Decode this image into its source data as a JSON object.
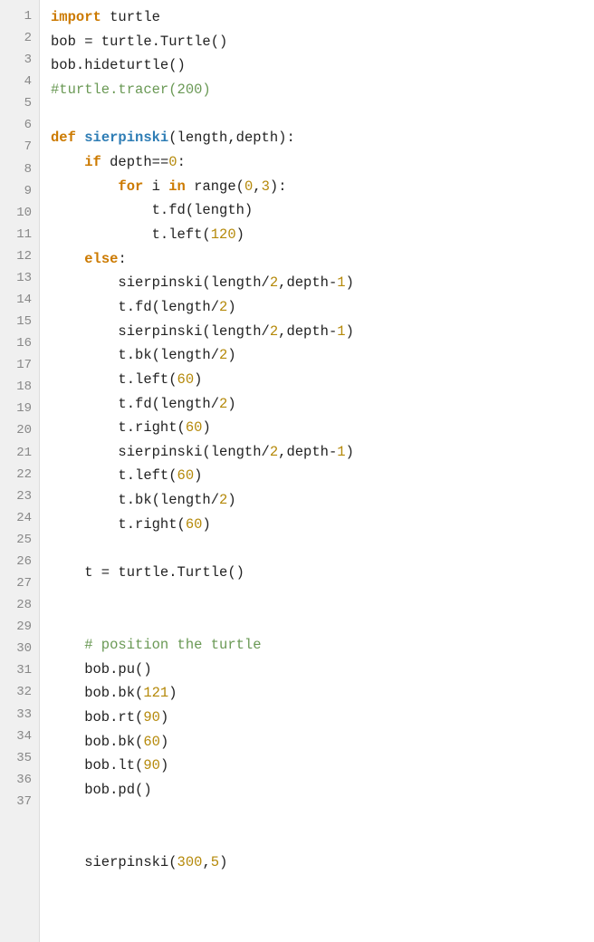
{
  "editor": {
    "lines": [
      {
        "num": 1,
        "tokens": [
          {
            "t": "kw",
            "v": "import"
          },
          {
            "t": "plain",
            "v": " turtle"
          }
        ]
      },
      {
        "num": 2,
        "tokens": [
          {
            "t": "plain",
            "v": "bob = turtle.Turtle()"
          }
        ]
      },
      {
        "num": 3,
        "tokens": [
          {
            "t": "plain",
            "v": "bob.hideturtle()"
          }
        ]
      },
      {
        "num": 4,
        "tokens": [
          {
            "t": "cm",
            "v": "#turtle.tracer(200)"
          }
        ]
      },
      {
        "num": 5,
        "tokens": [
          {
            "t": "plain",
            "v": ""
          }
        ]
      },
      {
        "num": 6,
        "tokens": [
          {
            "t": "kw",
            "v": "def"
          },
          {
            "t": "plain",
            "v": " "
          },
          {
            "t": "fn",
            "v": "sierpinski"
          },
          {
            "t": "plain",
            "v": "(length,depth):"
          }
        ]
      },
      {
        "num": 7,
        "tokens": [
          {
            "t": "plain",
            "v": "    "
          },
          {
            "t": "kw",
            "v": "if"
          },
          {
            "t": "plain",
            "v": " depth=="
          },
          {
            "t": "num",
            "v": "0"
          },
          {
            "t": "plain",
            "v": ":"
          }
        ]
      },
      {
        "num": 8,
        "tokens": [
          {
            "t": "plain",
            "v": "        "
          },
          {
            "t": "kw",
            "v": "for"
          },
          {
            "t": "plain",
            "v": " i "
          },
          {
            "t": "kw",
            "v": "in"
          },
          {
            "t": "plain",
            "v": " range("
          },
          {
            "t": "num",
            "v": "0"
          },
          {
            "t": "plain",
            "v": ","
          },
          {
            "t": "num",
            "v": "3"
          },
          {
            "t": "plain",
            "v": "):"
          }
        ]
      },
      {
        "num": 9,
        "tokens": [
          {
            "t": "plain",
            "v": "            t.fd(length)"
          }
        ]
      },
      {
        "num": 10,
        "tokens": [
          {
            "t": "plain",
            "v": "            t.left("
          },
          {
            "t": "num",
            "v": "120"
          },
          {
            "t": "plain",
            "v": ")"
          }
        ]
      },
      {
        "num": 11,
        "tokens": [
          {
            "t": "plain",
            "v": "    "
          },
          {
            "t": "kw",
            "v": "else"
          },
          {
            "t": "plain",
            "v": ":"
          }
        ]
      },
      {
        "num": 12,
        "tokens": [
          {
            "t": "plain",
            "v": "        sierpinski(length/"
          },
          {
            "t": "num",
            "v": "2"
          },
          {
            "t": "plain",
            "v": ",depth-"
          },
          {
            "t": "num",
            "v": "1"
          },
          {
            "t": "plain",
            "v": ")"
          }
        ]
      },
      {
        "num": 13,
        "tokens": [
          {
            "t": "plain",
            "v": "        t.fd(length/"
          },
          {
            "t": "num",
            "v": "2"
          },
          {
            "t": "plain",
            "v": ")"
          }
        ]
      },
      {
        "num": 14,
        "tokens": [
          {
            "t": "plain",
            "v": "        sierpinski(length/"
          },
          {
            "t": "num",
            "v": "2"
          },
          {
            "t": "plain",
            "v": ",depth-"
          },
          {
            "t": "num",
            "v": "1"
          },
          {
            "t": "plain",
            "v": ")"
          }
        ]
      },
      {
        "num": 15,
        "tokens": [
          {
            "t": "plain",
            "v": "        t.bk(length/"
          },
          {
            "t": "num",
            "v": "2"
          },
          {
            "t": "plain",
            "v": ")"
          }
        ]
      },
      {
        "num": 16,
        "tokens": [
          {
            "t": "plain",
            "v": "        t.left("
          },
          {
            "t": "num",
            "v": "60"
          },
          {
            "t": "plain",
            "v": ")"
          }
        ]
      },
      {
        "num": 17,
        "tokens": [
          {
            "t": "plain",
            "v": "        t.fd(length/"
          },
          {
            "t": "num",
            "v": "2"
          },
          {
            "t": "plain",
            "v": ")"
          }
        ]
      },
      {
        "num": 18,
        "tokens": [
          {
            "t": "plain",
            "v": "        t.right("
          },
          {
            "t": "num",
            "v": "60"
          },
          {
            "t": "plain",
            "v": ")"
          }
        ]
      },
      {
        "num": 19,
        "tokens": [
          {
            "t": "plain",
            "v": "        sierpinski(length/"
          },
          {
            "t": "num",
            "v": "2"
          },
          {
            "t": "plain",
            "v": ",depth-"
          },
          {
            "t": "num",
            "v": "1"
          },
          {
            "t": "plain",
            "v": ")"
          }
        ]
      },
      {
        "num": 20,
        "tokens": [
          {
            "t": "plain",
            "v": "        t.left("
          },
          {
            "t": "num",
            "v": "60"
          },
          {
            "t": "plain",
            "v": ")"
          }
        ]
      },
      {
        "num": 21,
        "tokens": [
          {
            "t": "plain",
            "v": "        t.bk(length/"
          },
          {
            "t": "num",
            "v": "2"
          },
          {
            "t": "plain",
            "v": ")"
          }
        ]
      },
      {
        "num": 22,
        "tokens": [
          {
            "t": "plain",
            "v": "        t.right("
          },
          {
            "t": "num",
            "v": "60"
          },
          {
            "t": "plain",
            "v": ")"
          }
        ]
      },
      {
        "num": 23,
        "tokens": [
          {
            "t": "plain",
            "v": ""
          }
        ]
      },
      {
        "num": 24,
        "tokens": [
          {
            "t": "plain",
            "v": "    t = turtle.Turtle()"
          }
        ]
      },
      {
        "num": 25,
        "tokens": [
          {
            "t": "plain",
            "v": ""
          }
        ]
      },
      {
        "num": 26,
        "tokens": [
          {
            "t": "plain",
            "v": ""
          }
        ]
      },
      {
        "num": 27,
        "tokens": [
          {
            "t": "cm",
            "v": "    # position the turtle"
          }
        ]
      },
      {
        "num": 28,
        "tokens": [
          {
            "t": "plain",
            "v": "    bob.pu()"
          }
        ]
      },
      {
        "num": 29,
        "tokens": [
          {
            "t": "plain",
            "v": "    bob.bk("
          },
          {
            "t": "num",
            "v": "121"
          },
          {
            "t": "plain",
            "v": ")"
          }
        ]
      },
      {
        "num": 30,
        "tokens": [
          {
            "t": "plain",
            "v": "    bob.rt("
          },
          {
            "t": "num",
            "v": "90"
          },
          {
            "t": "plain",
            "v": ")"
          }
        ]
      },
      {
        "num": 31,
        "tokens": [
          {
            "t": "plain",
            "v": "    bob.bk("
          },
          {
            "t": "num",
            "v": "60"
          },
          {
            "t": "plain",
            "v": ")"
          }
        ]
      },
      {
        "num": 32,
        "tokens": [
          {
            "t": "plain",
            "v": "    bob.lt("
          },
          {
            "t": "num",
            "v": "90"
          },
          {
            "t": "plain",
            "v": ")"
          }
        ]
      },
      {
        "num": 33,
        "tokens": [
          {
            "t": "plain",
            "v": "    bob.pd()"
          }
        ]
      },
      {
        "num": 34,
        "tokens": [
          {
            "t": "plain",
            "v": ""
          }
        ]
      },
      {
        "num": 35,
        "tokens": [
          {
            "t": "plain",
            "v": ""
          }
        ]
      },
      {
        "num": 36,
        "tokens": [
          {
            "t": "plain",
            "v": "    sierpinski("
          },
          {
            "t": "num",
            "v": "300"
          },
          {
            "t": "plain",
            "v": ","
          },
          {
            "t": "num",
            "v": "5"
          },
          {
            "t": "plain",
            "v": ")"
          }
        ]
      },
      {
        "num": 37,
        "tokens": [
          {
            "t": "plain",
            "v": ""
          }
        ]
      }
    ]
  }
}
